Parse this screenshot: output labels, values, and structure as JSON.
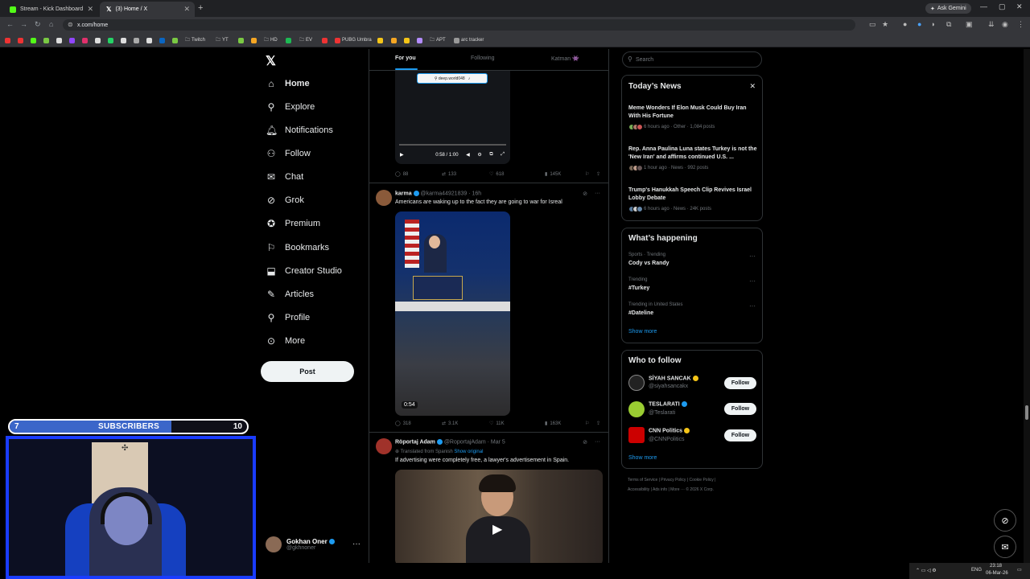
{
  "browser": {
    "tabs": [
      {
        "title": "Stream - Kick Dashboard",
        "active": false
      },
      {
        "title": "(3) Home / X",
        "active": true
      }
    ],
    "url": "x.com/home",
    "gemini": "Ask Gemini",
    "bookmarks": [
      "Twitch",
      "YT",
      "HD",
      "EV",
      "PUBG Umbra",
      "APT",
      "arc tracker"
    ]
  },
  "x": {
    "nav": [
      {
        "label": "Home",
        "icon": "home-icon"
      },
      {
        "label": "Explore",
        "icon": "search-icon"
      },
      {
        "label": "Notifications",
        "icon": "bell-icon"
      },
      {
        "label": "Follow",
        "icon": "person-add-icon"
      },
      {
        "label": "Chat",
        "icon": "mail-icon"
      },
      {
        "label": "Grok",
        "icon": "grok-icon"
      },
      {
        "label": "Premium",
        "icon": "premium-icon"
      },
      {
        "label": "Bookmarks",
        "icon": "bookmark-icon"
      },
      {
        "label": "Creator Studio",
        "icon": "creator-icon"
      },
      {
        "label": "Articles",
        "icon": "articles-icon"
      },
      {
        "label": "Profile",
        "icon": "profile-icon"
      },
      {
        "label": "More",
        "icon": "more-icon"
      }
    ],
    "post_label": "Post",
    "account": {
      "name": "Gokhan Oner",
      "handle": "@gkhnoner"
    }
  },
  "feed": {
    "tabs": [
      "For you",
      "Following",
      "Katman 👾"
    ],
    "tweet0": {
      "pill": "deep.world048",
      "time": "0:58 / 1:00",
      "replies": "88",
      "retweets": "133",
      "likes": "618",
      "views": "145K"
    },
    "tweet1": {
      "name": "karma",
      "handle": "@karma44921839 · 16h",
      "text": "Americans are waking up to the fact they are going to war for Isreal",
      "duration": "0:54",
      "replies": "318",
      "retweets": "3.1K",
      "likes": "11K",
      "views": "163K"
    },
    "tweet2": {
      "name": "Röportaj Adam",
      "handle": "@RoportajAdam · Mar 5",
      "translated": "Translated from Spanish",
      "show_original": "Show original",
      "text": "If advertising were completely free, a lawyer's advertisement in Spain."
    }
  },
  "sidebar": {
    "search_placeholder": "Search",
    "news_title": "Today’s News",
    "news": [
      {
        "title": "Meme Wonders If Elon Musk Could Buy Iran With His Fortune",
        "meta": "6 hours ago · Other · 1,084 posts"
      },
      {
        "title": "Rep. Anna Paulina Luna states Turkey is not the 'New Iran' and affirms continued U.S. ...",
        "meta": "1 hour ago · News · 992 posts"
      },
      {
        "title": "Trump's Hanukkah Speech Clip Revives Israel Lobby Debate",
        "meta": "6 hours ago · News · 24K posts"
      }
    ],
    "happening_title": "What’s happening",
    "trends": [
      {
        "context": "Sports · Trending",
        "title": "Cody vs Randy"
      },
      {
        "context": "Trending",
        "title": "#Turkey"
      },
      {
        "context": "Trending in United States",
        "title": "#Dateline"
      }
    ],
    "show_more": "Show more",
    "wtf_title": "Who to follow",
    "wtf": [
      {
        "name": "SİYAH SANCAK",
        "handle": "@siyahsancakx",
        "color": "#f5c518"
      },
      {
        "name": "TESLARATI",
        "handle": "@Teslarati",
        "color": "#1d9bf0"
      },
      {
        "name": "CNN Politics",
        "handle": "@CNNPolitics",
        "color": "#f5c518"
      }
    ],
    "follow_label": "Follow",
    "footer1": "Terms of Service  |  Privacy Policy  |  Cookie Policy  |",
    "footer2": "Accessibility  |  Ads info  |  More ···  © 2026 X Corp."
  },
  "overlay": {
    "sub_current": "7",
    "sub_label": "SUBSCRIBERS",
    "sub_goal": "10"
  },
  "taskbar": {
    "lang": "ENG",
    "time": "23:18",
    "date": "06-Mar-26"
  },
  "colors": {
    "accent": "#1d9bf0",
    "bg": "#000000",
    "border": "#2f3336"
  }
}
